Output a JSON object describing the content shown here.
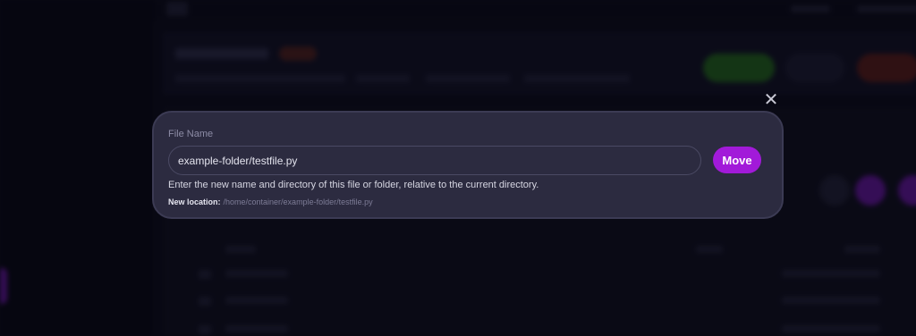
{
  "modal": {
    "close_icon": "close-icon",
    "field_label": "File Name",
    "input_value": "example-folder/testfile.py",
    "move_label": "Move",
    "help_text": "Enter the new name and directory of this file or folder, relative to the current directory.",
    "new_location_label": "New location:",
    "new_location_path": "/home/container/example-folder/testfile.py"
  },
  "colors": {
    "accent": "#a21ad9",
    "modal_bg": "#2c2b40",
    "page_bg": "#0c0c18"
  }
}
